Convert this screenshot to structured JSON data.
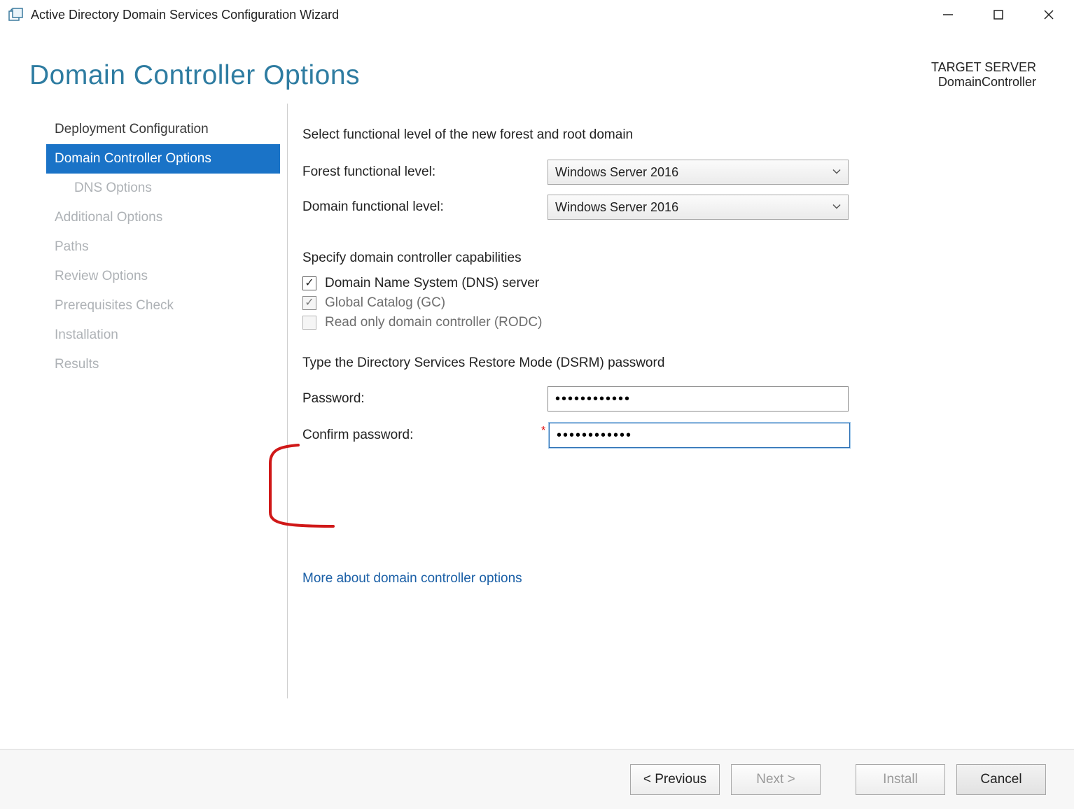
{
  "window": {
    "title": "Active Directory Domain Services Configuration Wizard"
  },
  "header": {
    "page_title": "Domain Controller Options",
    "target_label": "TARGET SERVER",
    "target_name": "DomainController"
  },
  "sidebar": {
    "items": [
      {
        "label": "Deployment Configuration",
        "state": "completed"
      },
      {
        "label": "Domain Controller Options",
        "state": "active"
      },
      {
        "label": "DNS Options",
        "state": "disabled",
        "indent": true
      },
      {
        "label": "Additional Options",
        "state": "disabled"
      },
      {
        "label": "Paths",
        "state": "disabled"
      },
      {
        "label": "Review Options",
        "state": "disabled"
      },
      {
        "label": "Prerequisites Check",
        "state": "disabled"
      },
      {
        "label": "Installation",
        "state": "disabled"
      },
      {
        "label": "Results",
        "state": "disabled"
      }
    ]
  },
  "main": {
    "func_level_heading": "Select functional level of the new forest and root domain",
    "forest_level_label": "Forest functional level:",
    "forest_level_value": "Windows Server 2016",
    "domain_level_label": "Domain functional level:",
    "domain_level_value": "Windows Server 2016",
    "capabilities_heading": "Specify domain controller capabilities",
    "cap_dns": "Domain Name System (DNS) server",
    "cap_gc": "Global Catalog (GC)",
    "cap_rodc": "Read only domain controller (RODC)",
    "dsrm_heading": "Type the Directory Services Restore Mode (DSRM) password",
    "password_label": "Password:",
    "confirm_label": "Confirm password:",
    "password_value": "••••••••••••",
    "confirm_value": "••••••••••••",
    "more_link": "More about domain controller options"
  },
  "footer": {
    "previous": "< Previous",
    "next": "Next >",
    "install": "Install",
    "cancel": "Cancel"
  },
  "colors": {
    "accent": "#1a73c7",
    "title_teal": "#2e7ca1",
    "link": "#1a5fa6"
  }
}
